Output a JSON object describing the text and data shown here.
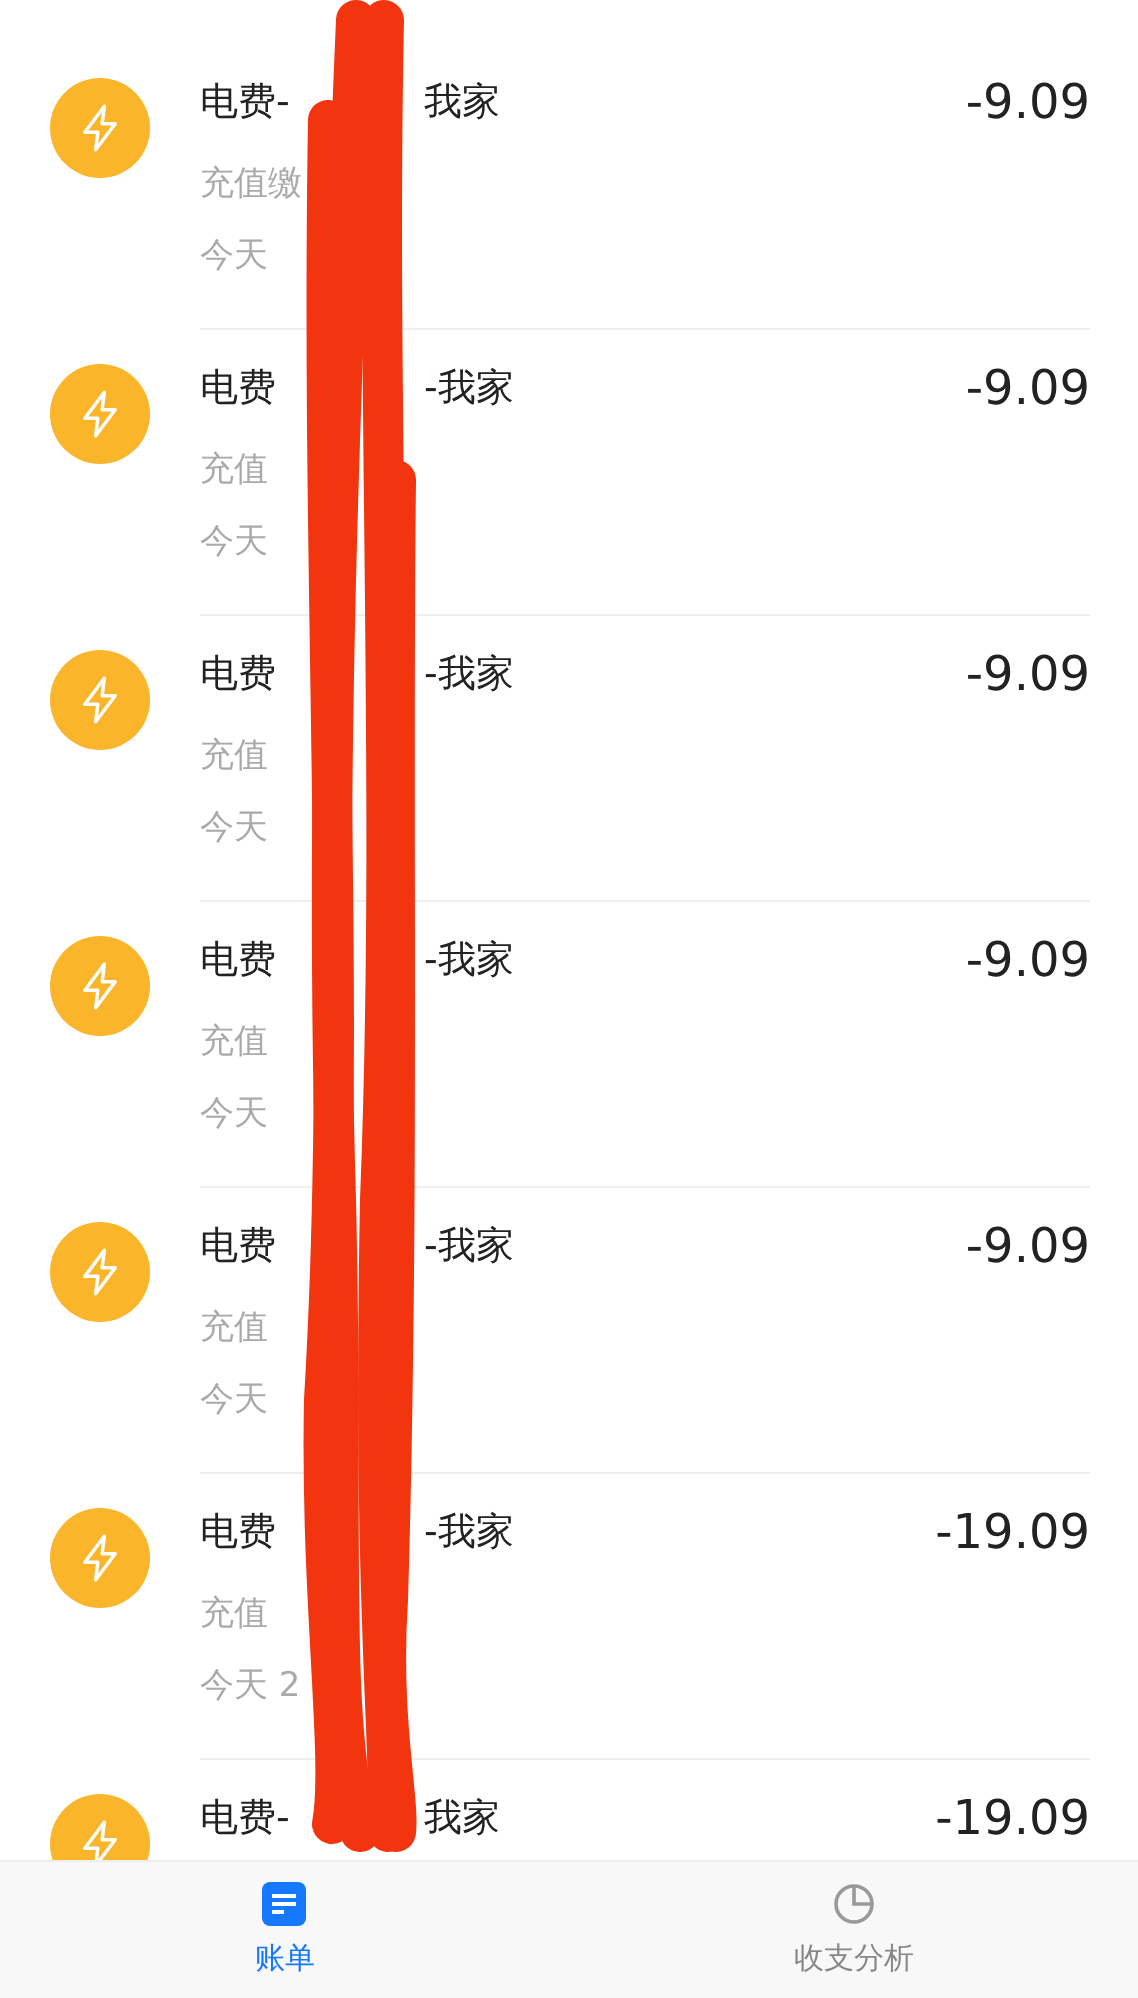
{
  "transactions": [
    {
      "title_start": "电费-",
      "title_end": "我家",
      "subtitle": "充值缴",
      "date": "今天",
      "amount": "-9.09"
    },
    {
      "title_start": "电费",
      "title_end": "-我家",
      "subtitle": "充值",
      "date": "今天",
      "amount": "-9.09"
    },
    {
      "title_start": "电费",
      "title_end": "-我家",
      "subtitle": "充值",
      "date": "今天",
      "amount": "-9.09"
    },
    {
      "title_start": "电费",
      "title_end": "-我家",
      "subtitle": "充值",
      "date": "今天",
      "amount": "-9.09"
    },
    {
      "title_start": "电费",
      "title_end": "-我家",
      "subtitle": "充值",
      "date": "今天",
      "amount": "-9.09"
    },
    {
      "title_start": "电费",
      "title_end": "-我家",
      "subtitle": "充值",
      "date": "今天 2",
      "amount": "-19.09"
    },
    {
      "title_start": "电费-",
      "title_end": "我家",
      "amount": "-19.09"
    }
  ],
  "tab_bar": [
    {
      "label": "账单",
      "selected": true
    },
    {
      "label": "收支分析",
      "selected": false
    }
  ]
}
